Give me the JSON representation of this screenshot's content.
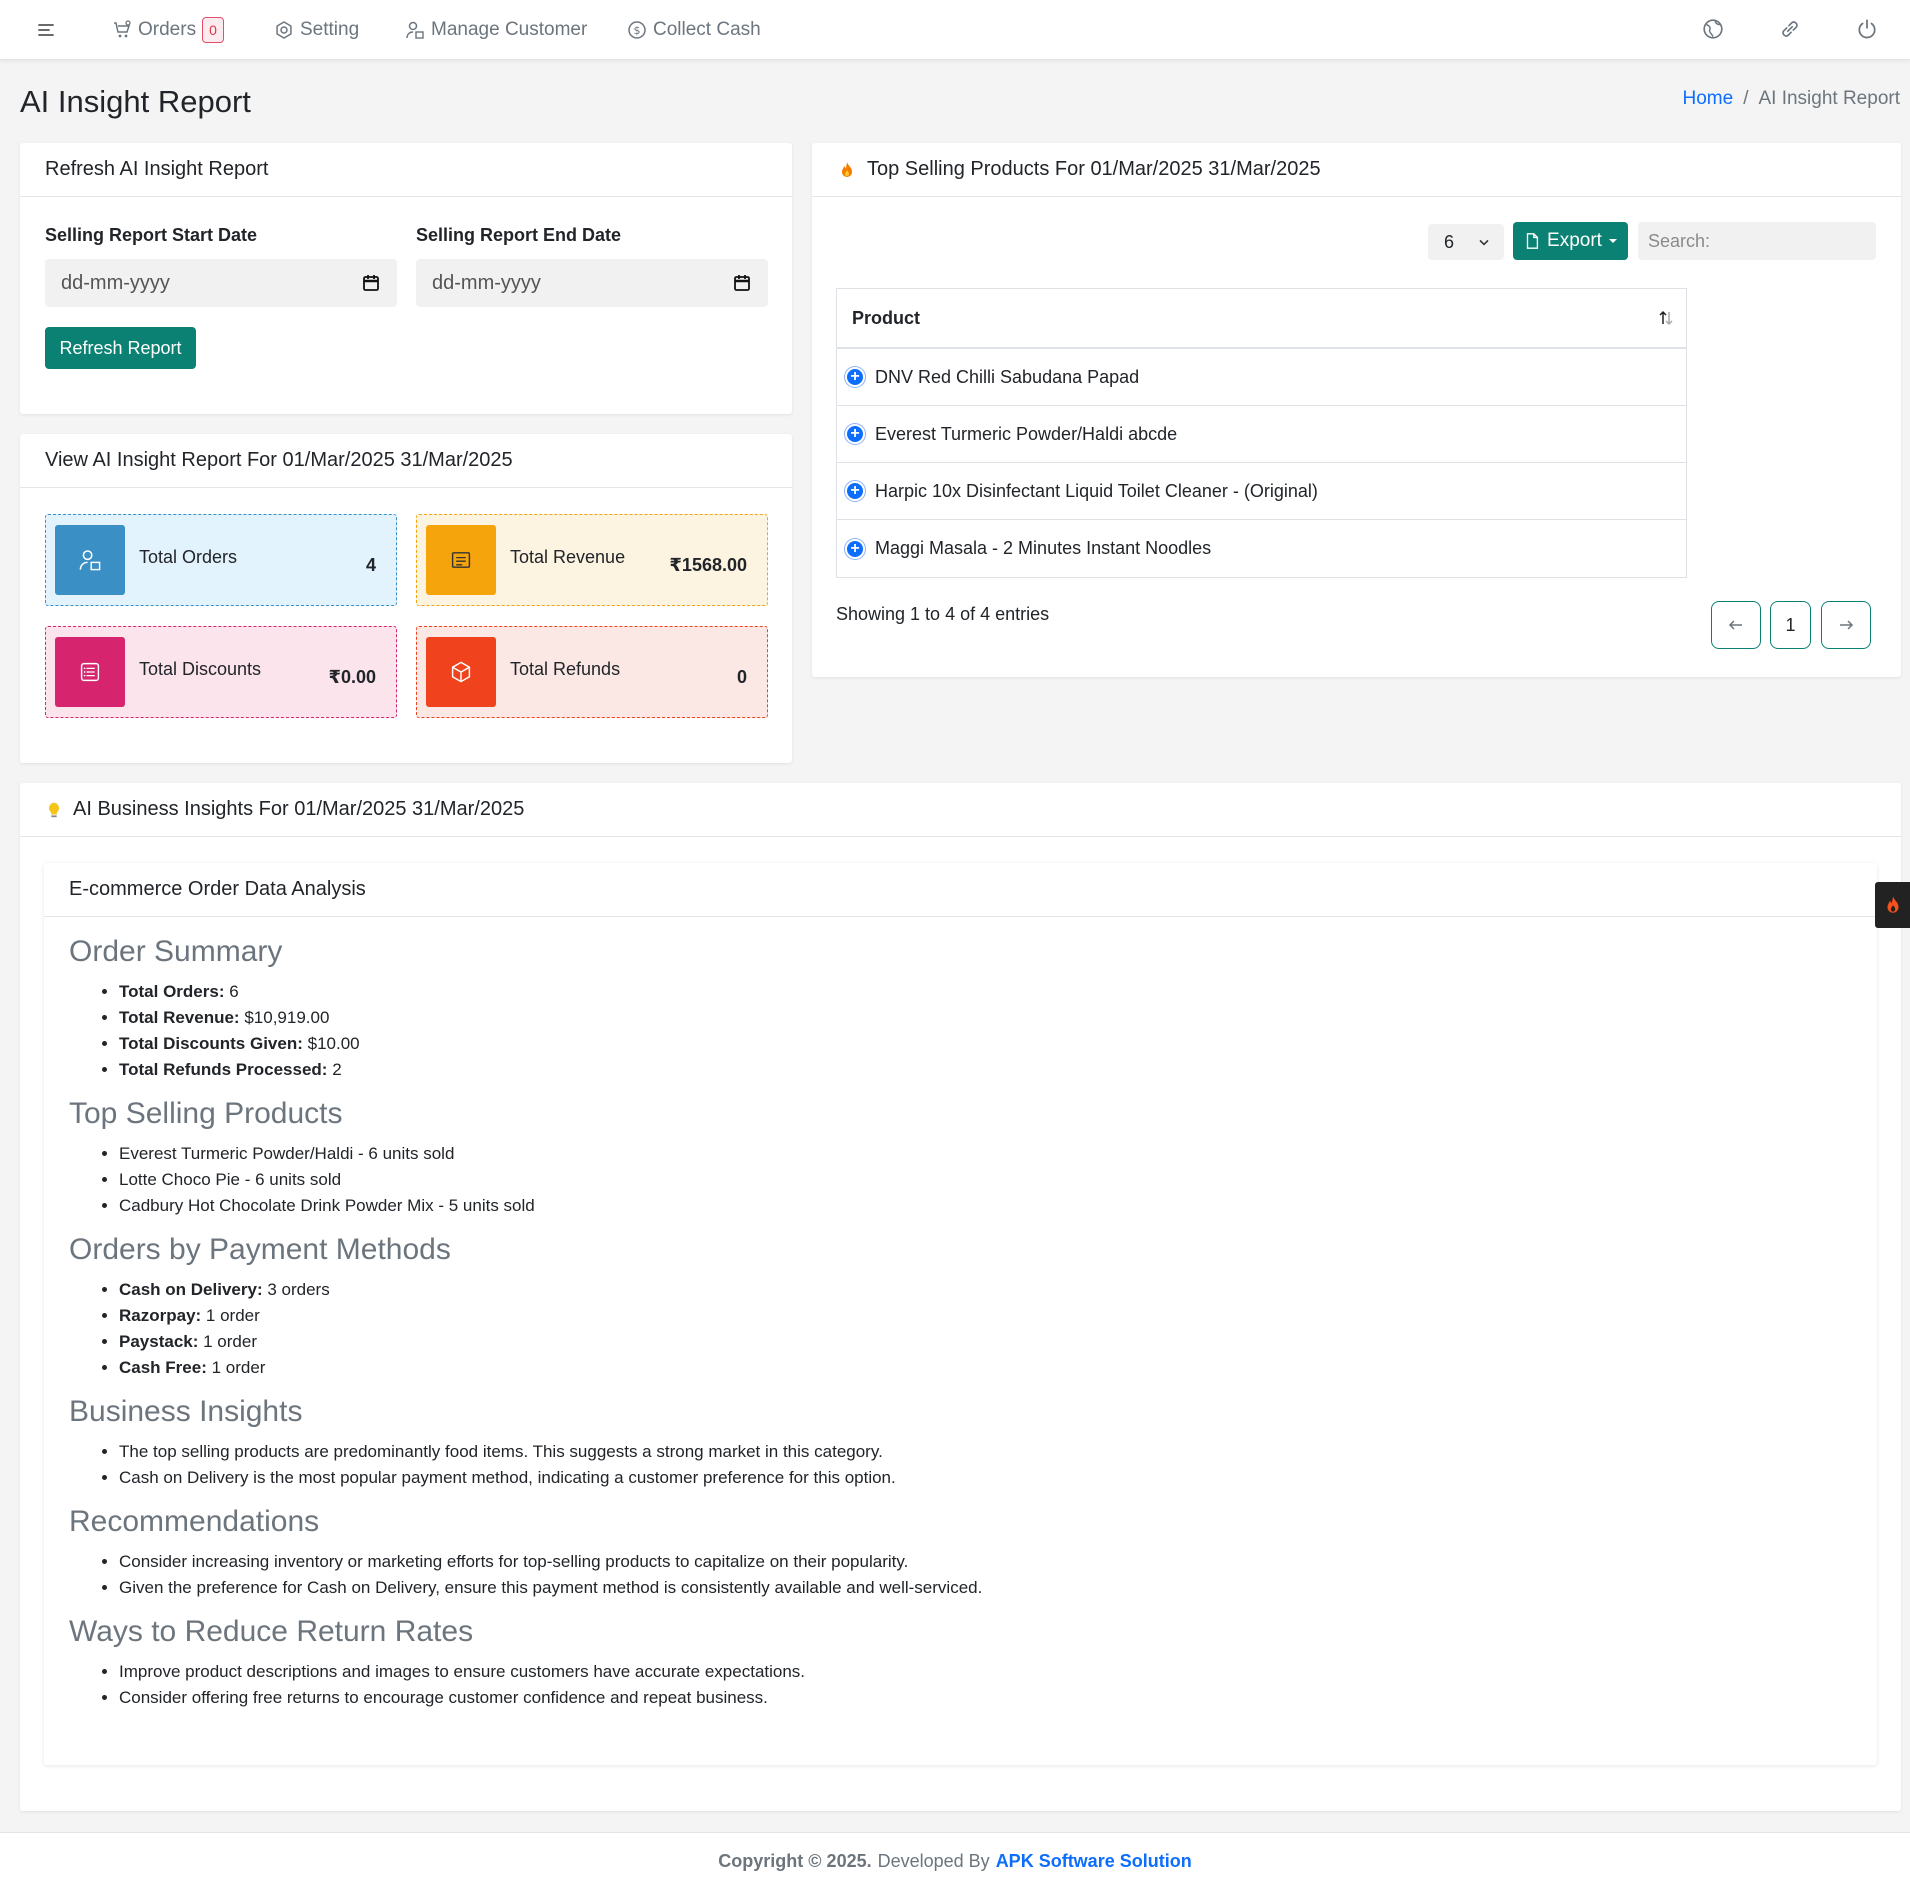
{
  "nav": {
    "orders_label": "Orders",
    "orders_count": "0",
    "setting_label": "Setting",
    "manage_customer_label": "Manage Customer",
    "collect_cash_label": "Collect Cash"
  },
  "page": {
    "title": "AI Insight Report",
    "breadcrumb_home": "Home",
    "breadcrumb_sep": "/",
    "breadcrumb_current": "AI Insight Report"
  },
  "refresh_card": {
    "title": "Refresh AI Insight Report",
    "start_label": "Selling Report Start Date",
    "end_label": "Selling Report End Date",
    "start_placeholder": "dd-mm-yyyy",
    "end_placeholder": "dd-mm-yyyy",
    "button_label": "Refresh Report"
  },
  "view_card": {
    "title": "View AI Insight Report For 01/Mar/2025 31/Mar/2025",
    "stats": [
      {
        "label": "Total Orders",
        "value": "4"
      },
      {
        "label": "Total Revenue",
        "value": "₹1568.00"
      },
      {
        "label": "Total Discounts",
        "value": "₹0.00"
      },
      {
        "label": "Total Refunds",
        "value": "0"
      }
    ]
  },
  "top_selling": {
    "title": "Top Selling Products For 01/Mar/2025 31/Mar/2025",
    "page_size": "6",
    "export_label": "Export",
    "search_placeholder": "Search:",
    "column_header": "Product",
    "rows": [
      "DNV Red Chilli Sabudana Papad",
      "Everest Turmeric Powder/Haldi abcde",
      "Harpic 10x Disinfectant Liquid Toilet Cleaner - (Original)",
      "Maggi Masala - 2 Minutes Instant Noodles"
    ],
    "showing_text": "Showing 1 to 4 of 4 entries",
    "current_page": "1"
  },
  "insights": {
    "title": "AI Business Insights For 01/Mar/2025 31/Mar/2025",
    "inner_title": "E-commerce Order Data Analysis",
    "order_summary": {
      "heading": "Order Summary",
      "items": [
        {
          "label": "Total Orders:",
          "value": "6"
        },
        {
          "label": "Total Revenue:",
          "value": "$10,919.00"
        },
        {
          "label": "Total Discounts Given:",
          "value": "$10.00"
        },
        {
          "label": "Total Refunds Processed:",
          "value": "2"
        }
      ]
    },
    "top_products": {
      "heading": "Top Selling Products",
      "items": [
        "Everest Turmeric Powder/Haldi - 6 units sold",
        "Lotte Choco Pie - 6 units sold",
        "Cadbury Hot Chocolate Drink Powder Mix - 5 units sold"
      ]
    },
    "payment_methods": {
      "heading": "Orders by Payment Methods",
      "items": [
        {
          "label": "Cash on Delivery:",
          "value": "3 orders"
        },
        {
          "label": "Razorpay:",
          "value": "1 order"
        },
        {
          "label": "Paystack:",
          "value": "1 order"
        },
        {
          "label": "Cash Free:",
          "value": "1 order"
        }
      ]
    },
    "business_insights": {
      "heading": "Business Insights",
      "items": [
        "The top selling products are predominantly food items. This suggests a strong market in this category.",
        "Cash on Delivery is the most popular payment method, indicating a customer preference for this option."
      ]
    },
    "recommendations": {
      "heading": "Recommendations",
      "items": [
        "Consider increasing inventory or marketing efforts for top-selling products to capitalize on their popularity.",
        "Given the preference for Cash on Delivery, ensure this payment method is consistently available and well-serviced."
      ]
    },
    "return_rates": {
      "heading": "Ways to Reduce Return Rates",
      "items": [
        "Improve product descriptions and images to ensure customers have accurate expectations.",
        "Consider offering free returns to encourage customer confidence and repeat business."
      ]
    }
  },
  "footer": {
    "copyright": "Copyright © 2025.",
    "developed_by": "Developed By",
    "brand": "APK Software Solution"
  },
  "colors": {
    "teal": "#0b8173",
    "orders_box": "#3a8fc4",
    "revenue_box": "#f5a50b",
    "discounts_box": "#d6246e",
    "refunds_box": "#f0421c",
    "link": "#0d6efd"
  },
  "icons": [
    "menu-icon",
    "cart-icon",
    "gear-icon",
    "user-icon",
    "coin-icon",
    "globe-icon",
    "link-icon",
    "power-icon",
    "calendar-icon",
    "fire-icon",
    "bulb-icon",
    "file-icon"
  ]
}
